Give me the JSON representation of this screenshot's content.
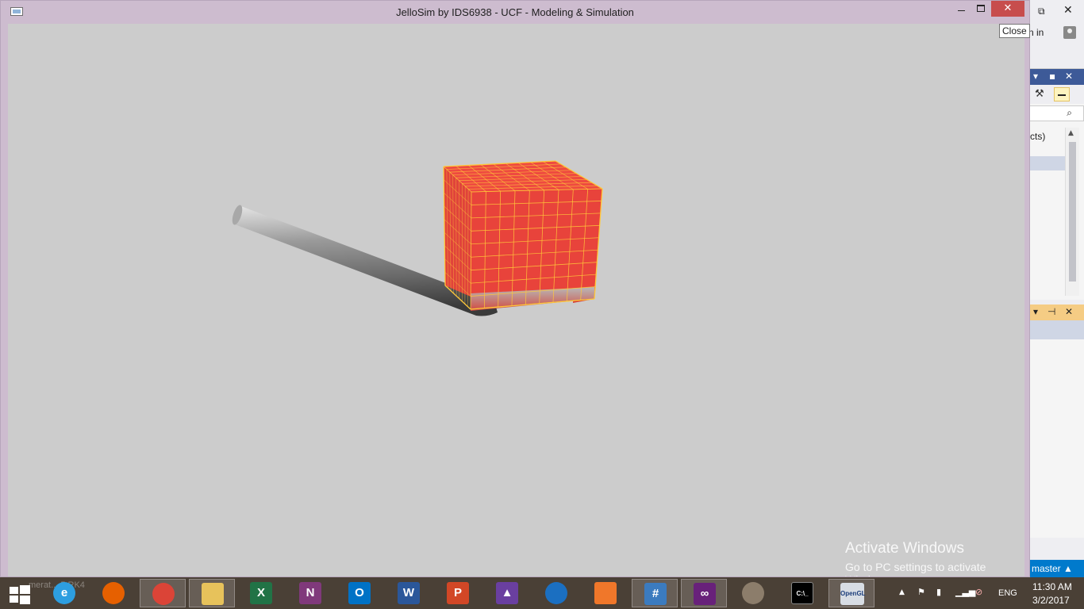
{
  "window": {
    "title": "JelloSim by IDS6938 - UCF - Modeling & Simulation",
    "close_tooltip": "Close",
    "minimize_glyph": "–",
    "close_glyph": "✕"
  },
  "scene": {
    "background": "#cccccc",
    "jello_color": "#e8433b",
    "grid_color": "#ffc83a",
    "cylinder_color": "#8a8a8a"
  },
  "watermark": {
    "title": "Activate Windows",
    "subtitle": "Go to PC settings to activate Windows."
  },
  "ide_background": {
    "sign_in": "n in",
    "tree_text": "cts)",
    "status_branch": "master ▲"
  },
  "taskbar": {
    "ghost_text": "merat... 5 RK4",
    "apps": [
      {
        "name": "internet-explorer",
        "label": "e",
        "color": "#2d9ee0",
        "round": true
      },
      {
        "name": "firefox",
        "label": "",
        "color": "#e66000",
        "round": true
      },
      {
        "name": "chrome",
        "label": "",
        "color": "#db4437",
        "round": true
      },
      {
        "name": "file-explorer",
        "label": "",
        "color": "#e7c25b",
        "round": false
      },
      {
        "name": "excel",
        "label": "X",
        "color": "#217346",
        "round": false
      },
      {
        "name": "onenote",
        "label": "N",
        "color": "#80397b",
        "round": false
      },
      {
        "name": "outlook",
        "label": "O",
        "color": "#0072c6",
        "round": false
      },
      {
        "name": "word",
        "label": "W",
        "color": "#2b579a",
        "round": false
      },
      {
        "name": "powerpoint",
        "label": "P",
        "color": "#d24726",
        "round": false
      },
      {
        "name": "3d-app",
        "label": "▲",
        "color": "#6a3fa0",
        "round": false
      },
      {
        "name": "globe-app",
        "label": "",
        "color": "#1b6fc1",
        "round": true
      },
      {
        "name": "origin-app",
        "label": "",
        "color": "#f0772a",
        "round": false
      },
      {
        "name": "csharp-app",
        "label": "#",
        "color": "#3b7bbf",
        "round": false
      },
      {
        "name": "visual-studio",
        "label": "∞",
        "color": "#68217a",
        "round": false
      },
      {
        "name": "paint",
        "label": "",
        "color": "#8c7d6b",
        "round": true
      },
      {
        "name": "command-prompt",
        "label": "C:\\_",
        "color": "#000000",
        "round": false
      },
      {
        "name": "opengl-app",
        "label": "OpenGL",
        "color": "#d8dde4",
        "round": false
      }
    ],
    "tray": {
      "chevron": "▲",
      "flag": "⚑",
      "lang": "ENG"
    },
    "clock": {
      "time": "11:30 AM",
      "date": "3/2/2017"
    }
  }
}
